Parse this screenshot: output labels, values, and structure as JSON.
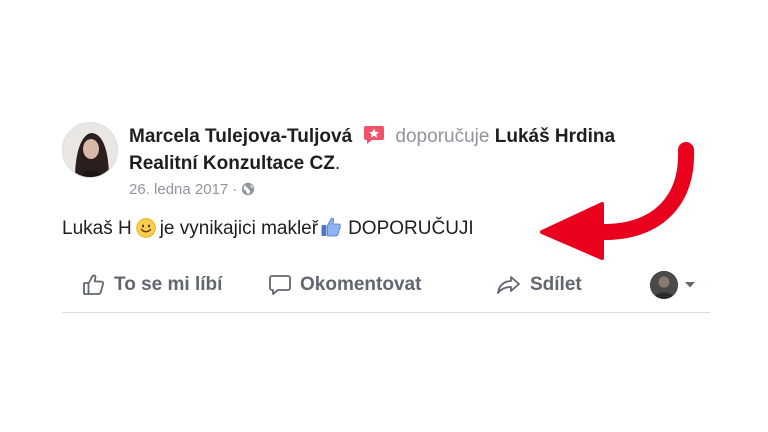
{
  "post": {
    "author": "Marcela Tulejova-Tuljová",
    "action_text": "doporučuje",
    "page_name_part1": "Lukáš Hrdina",
    "page_name_part2": "Realitní Konzultace CZ",
    "page_name_suffix": ".",
    "date": "26. ledna 2017",
    "separator": "·",
    "privacy_icon": "globe-icon",
    "text_before_emoji": "Lukaš H",
    "text_middle": "je vynikajici makleř",
    "text_after_thumb": "DOPORUČUJI"
  },
  "actions": {
    "like_label": "To se mi líbí",
    "comment_label": "Okomentovat",
    "share_label": "Sdílet"
  },
  "icons": {
    "recommend_badge": "recommend-star-icon",
    "emoji": "smiley-icon",
    "thumb": "thumbs-up-icon",
    "annotation": "red-arrow-icon"
  },
  "colors": {
    "recommend_badge": "#f25268",
    "secondary_text": "#90949c",
    "action_text": "#606770",
    "arrow": "#e8001c"
  }
}
